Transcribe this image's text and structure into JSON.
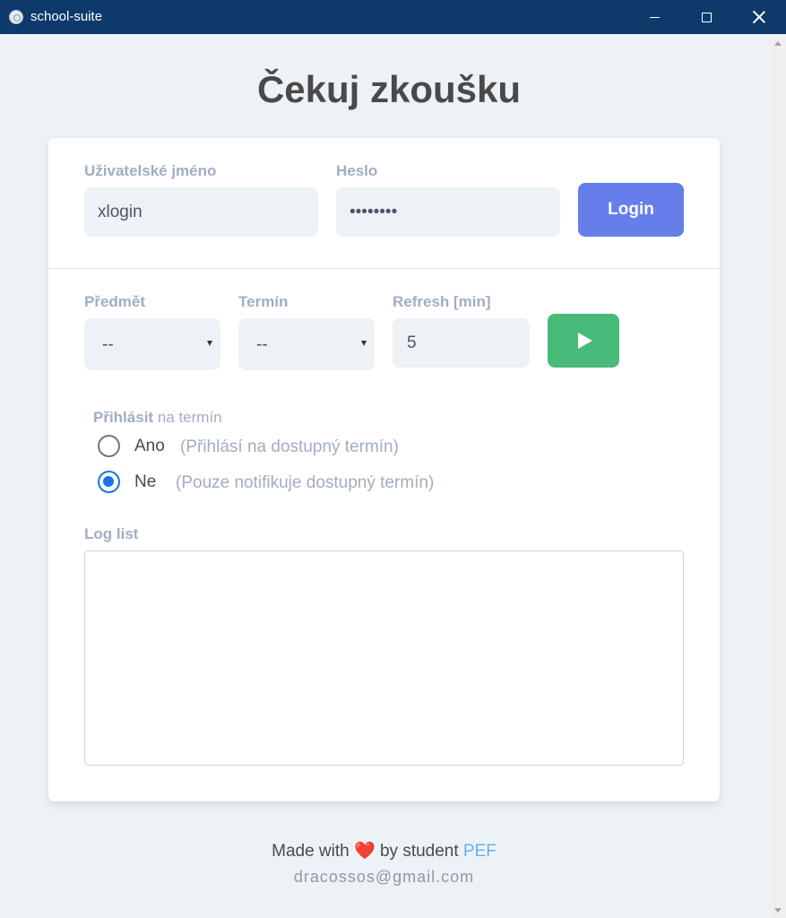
{
  "window": {
    "title": "school-suite"
  },
  "page": {
    "title": "Čekuj zkoušku"
  },
  "login": {
    "username_label": "Uživatelské jméno",
    "username_value": "xlogin",
    "password_label": "Heslo",
    "password_value": "password",
    "login_button": "Login",
    "login_button_color": "#667eea"
  },
  "watch": {
    "subject_label": "Předmět",
    "subject_value": "--",
    "term_label": "Termín",
    "term_value": "--",
    "refresh_label": "Refresh [min]",
    "refresh_value": "5",
    "start_button_icon": "play-icon",
    "start_button_color": "#48bb78"
  },
  "signup": {
    "heading_strong": "Přihlásit",
    "heading_rest": " na termín",
    "options": [
      {
        "label": "Ano",
        "hint": "(Přihlásí na dostupný termín)",
        "checked": false
      },
      {
        "label": "Ne",
        "hint": "(Pouze notifikuje dostupný termín)",
        "checked": true
      }
    ]
  },
  "log": {
    "label": "Log list",
    "content": ""
  },
  "footer": {
    "made_with": "Made with",
    "heart_icon": "heart-icon",
    "by_student": "by student",
    "link_text": "PEF",
    "email": "dracossos@gmail.com"
  }
}
